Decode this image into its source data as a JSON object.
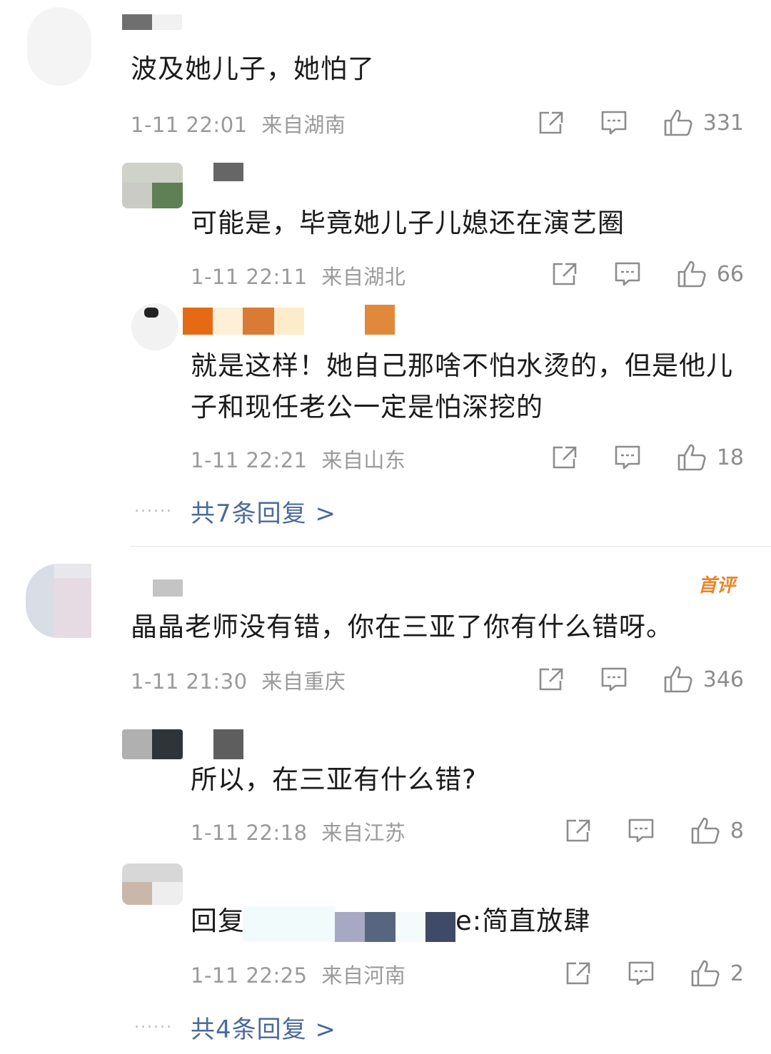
{
  "threads": [
    {
      "comment": {
        "text": "波及她儿子，她怕了",
        "time": "1-11 22:01",
        "location": "来自湖南",
        "likes": "331"
      },
      "replies": [
        {
          "text": "可能是，毕竟她儿子儿媳还在演艺圈",
          "time": "1-11 22:11",
          "location": "来自湖北",
          "likes": "66"
        },
        {
          "text": "就是这样！她自己那啥不怕水烫的，但是他儿子和现任老公一定是怕深挖的",
          "time": "1-11 22:21",
          "location": "来自山东",
          "likes": "18"
        }
      ],
      "more_replies": "共7条回复 >"
    },
    {
      "badge": "首评",
      "comment": {
        "text": "晶晶老师没有错，你在三亚了你有什么错呀。",
        "time": "1-11 21:30",
        "location": "来自重庆",
        "likes": "346"
      },
      "replies": [
        {
          "text": "所以，在三亚有什么错?",
          "time": "1-11 22:18",
          "location": "来自江苏",
          "likes": "8"
        },
        {
          "text_prefix": "回复",
          "text_suffix": "e:简直放肆",
          "time": "1-11 22:25",
          "location": "来自河南",
          "likes": "2"
        }
      ],
      "more_replies": "共4条回复 >"
    }
  ],
  "dots": "......",
  "icons": {
    "share": "share-icon",
    "comment": "comment-icon",
    "like": "thumbs-up-icon"
  },
  "colors": {
    "link": "#4a6a9a",
    "meta": "#9a9a9a",
    "badge": "#e8852a"
  }
}
